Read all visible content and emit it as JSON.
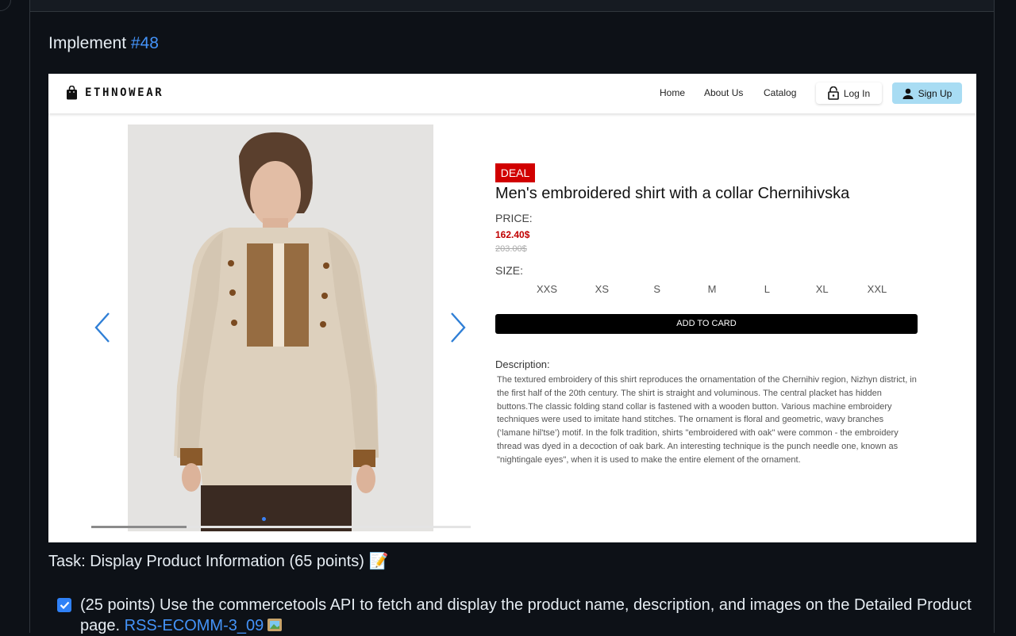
{
  "header": {
    "implement_prefix": "Implement ",
    "issue_ref": "#48"
  },
  "shop": {
    "brand": "ETHNOWEAR",
    "nav": {
      "home": "Home",
      "about": "About Us",
      "catalog": "Catalog",
      "login": "Log In",
      "signup": "Sign Up"
    },
    "product": {
      "badge": "DEAL",
      "name": "Men's embroidered shirt with a collar Chernihivska",
      "price_label": "PRICE:",
      "price": "162.40$",
      "old_price": "203.00$",
      "size_label": "SIZE:",
      "sizes": [
        "XXS",
        "XS",
        "S",
        "M",
        "L",
        "XL",
        "XXL"
      ],
      "add_button": "ADD TO CARD",
      "description_label": "Description:",
      "description": "The textured embroidery of this shirt reproduces the ornamentation of the Chernihiv region, Nizhyn district, in the first half of the 20th century. The shirt is straight and voluminous. The central placket has hidden buttons.The classic folding stand collar is fastened with a wooden button. Various machine embroidery techniques were used to imitate hand stitches. The ornament is floral and geometric, wavy branches (‘lamane hil'tse’) motif. In the folk tradition, shirts \"embroidered with oak\" were common - the embroidery thread was dyed in a decoction of oak bark. An interesting technique is the punch needle one, known as \"nightingale eyes\", when it is used to make the entire element of the ornament."
    },
    "carousel": {
      "progress": 0.25,
      "accent": "#3b82f6"
    }
  },
  "task": {
    "title": "Task: Display Product Information (65 points) 📝",
    "item_text": "(25 points) Use the commercetools API to fetch and display the product name, description, and images on the Detailed Product page.",
    "item_link": "RSS-ECOMM-3_09",
    "checked": true
  },
  "colors": {
    "page_bg": "#0d1117",
    "link": "#4493f8",
    "deal_red": "#d10000",
    "price_red": "#c00000",
    "signup_bg": "#a8dcf3"
  }
}
